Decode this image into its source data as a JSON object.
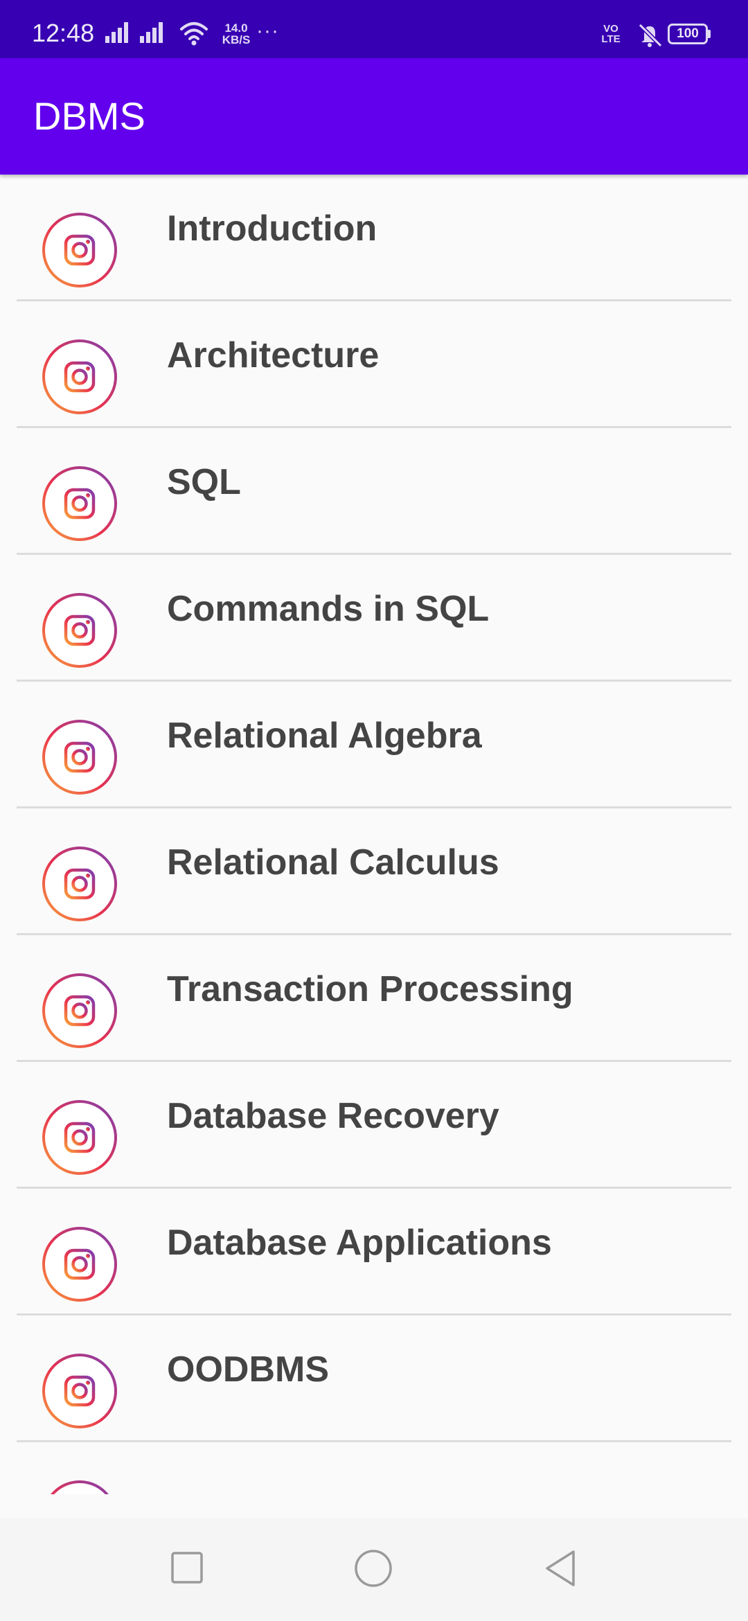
{
  "status_bar": {
    "time": "12:48",
    "net_speed_value": "14.0",
    "net_speed_unit": "KB/S",
    "overflow": "···",
    "volte_top": "VO",
    "volte_bottom": "LTE",
    "battery": "100",
    "icons": [
      "signal-icon",
      "signal-icon",
      "wifi-icon",
      "volte-icon",
      "mute-icon",
      "battery-icon"
    ]
  },
  "app_bar": {
    "title": "DBMS",
    "color": "#6200ee",
    "status_color": "#3700b3"
  },
  "list": {
    "icon": "instagram-icon",
    "items": [
      {
        "label": "Introduction"
      },
      {
        "label": "Architecture"
      },
      {
        "label": "SQL"
      },
      {
        "label": "Commands in SQL"
      },
      {
        "label": "Relational Algebra"
      },
      {
        "label": "Relational Calculus"
      },
      {
        "label": "Transaction Processing"
      },
      {
        "label": "Database Recovery"
      },
      {
        "label": "Database Applications"
      },
      {
        "label": "OODBMS"
      },
      {
        "label": ""
      }
    ]
  },
  "nav_bar": {
    "buttons": [
      "recents-icon",
      "home-icon",
      "back-icon"
    ]
  }
}
